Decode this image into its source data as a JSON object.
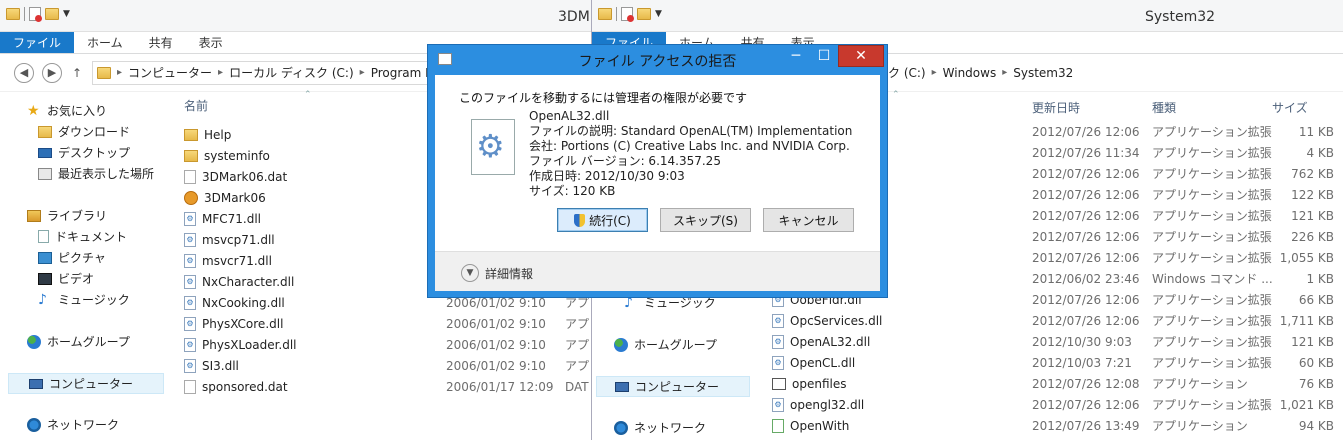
{
  "left_window": {
    "title": "3DM",
    "ribbon_tabs": [
      "ファイル",
      "ホーム",
      "共有",
      "表示"
    ],
    "address": [
      "コンピューター",
      "ローカル ディスク (C:)",
      "Program F"
    ],
    "column_name": "名前",
    "nav": {
      "favorites": "お気に入り",
      "downloads": "ダウンロード",
      "desktop": "デスクトップ",
      "recent": "最近表示した場所",
      "libraries": "ライブラリ",
      "documents": "ドキュメント",
      "pictures": "ピクチャ",
      "videos": "ビデオ",
      "music": "ミュージック",
      "homegroup": "ホームグループ",
      "computer": "コンピューター",
      "network": "ネットワーク"
    },
    "files": [
      {
        "name": "Help",
        "icon": "folder-icon",
        "date": "",
        "type": ""
      },
      {
        "name": "systeminfo",
        "icon": "folder-icon",
        "date": "",
        "type": ""
      },
      {
        "name": "3DMark06.dat",
        "icon": "file-icon",
        "date": "",
        "type": ""
      },
      {
        "name": "3DMark06",
        "icon": "app-icon",
        "date": "",
        "type": ""
      },
      {
        "name": "MFC71.dll",
        "icon": "dll-icon",
        "date": "",
        "type": ""
      },
      {
        "name": "msvcp71.dll",
        "icon": "dll-icon",
        "date": "",
        "type": ""
      },
      {
        "name": "msvcr71.dll",
        "icon": "dll-icon",
        "date": "",
        "type": ""
      },
      {
        "name": "NxCharacter.dll",
        "icon": "dll-icon",
        "date": "",
        "type": ""
      },
      {
        "name": "NxCooking.dll",
        "icon": "dll-icon",
        "date": "2006/01/02 9:10",
        "type": "アプ"
      },
      {
        "name": "PhysXCore.dll",
        "icon": "dll-icon",
        "date": "2006/01/02 9:10",
        "type": "アプ"
      },
      {
        "name": "PhysXLoader.dll",
        "icon": "dll-icon",
        "date": "2006/01/02 9:10",
        "type": "アプ"
      },
      {
        "name": "SI3.dll",
        "icon": "dll-icon",
        "date": "2006/01/02 9:10",
        "type": "アプ"
      },
      {
        "name": "sponsored.dat",
        "icon": "file-icon",
        "date": "2006/01/17 12:09",
        "type": "DAT"
      }
    ]
  },
  "right_window": {
    "title": "System32",
    "ribbon_tabs": [
      "ファイル",
      "ホーム",
      "共有",
      "表示"
    ],
    "address": [
      "スク (C:)",
      "Windows",
      "System32"
    ],
    "columns": {
      "date": "更新日時",
      "type": "種類",
      "size": "サイズ"
    },
    "nav": {
      "music": "ミュージック",
      "homegroup": "ホームグループ",
      "computer": "コンピューター",
      "network": "ネットワーク"
    },
    "files": [
      {
        "name": "",
        "date": "2012/07/26 12:06",
        "type": "アプリケーション拡張",
        "size": "11 KB"
      },
      {
        "name": "",
        "date": "2012/07/26 11:34",
        "type": "アプリケーション拡張",
        "size": "4 KB"
      },
      {
        "name": "",
        "date": "2012/07/26 12:06",
        "type": "アプリケーション拡張",
        "size": "762 KB"
      },
      {
        "name": "",
        "date": "2012/07/26 12:06",
        "type": "アプリケーション拡張",
        "size": "122 KB"
      },
      {
        "name": "",
        "date": "2012/07/26 12:06",
        "type": "アプリケーション拡張",
        "size": "121 KB"
      },
      {
        "name": "",
        "date": "2012/07/26 12:06",
        "type": "アプリケーション拡張",
        "size": "226 KB"
      },
      {
        "name": "",
        "date": "2012/07/26 12:06",
        "type": "アプリケーション拡張",
        "size": "1,055 KB"
      },
      {
        "name": "",
        "date": "2012/06/02 23:46",
        "type": "Windows コマンド ...",
        "size": "1 KB"
      },
      {
        "name": "OobeFldr.dll",
        "date": "2012/07/26 12:06",
        "type": "アプリケーション拡張",
        "size": "66 KB"
      },
      {
        "name": "OpcServices.dll",
        "date": "2012/07/26 12:06",
        "type": "アプリケーション拡張",
        "size": "1,711 KB"
      },
      {
        "name": "OpenAL32.dll",
        "date": "2012/10/30 9:03",
        "type": "アプリケーション拡張",
        "size": "121 KB"
      },
      {
        "name": "OpenCL.dll",
        "date": "2012/10/03 7:21",
        "type": "アプリケーション拡張",
        "size": "60 KB"
      },
      {
        "name": "openfiles",
        "date": "2012/07/26 12:08",
        "type": "アプリケーション",
        "size": "76 KB"
      },
      {
        "name": "opengl32.dll",
        "date": "2012/07/26 12:06",
        "type": "アプリケーション拡張",
        "size": "1,021 KB"
      },
      {
        "name": "OpenWith",
        "date": "2012/07/26 13:49",
        "type": "アプリケーション",
        "size": "94 KB"
      }
    ]
  },
  "dialog": {
    "title": "ファイル アクセスの拒否",
    "message": "このファイルを移動するには管理者の権限が必要です",
    "file_name": "OpenAL32.dll",
    "description": "ファイルの説明: Standard OpenAL(TM) Implementation",
    "company": "会社: Portions (C) Creative Labs Inc. and NVIDIA Corp.",
    "version": "ファイル バージョン: 6.14.357.25",
    "created": "作成日時: 2012/10/30 9:03",
    "size": "サイズ: 120 KB",
    "continue_label": "続行(C)",
    "skip_label": "スキップ(S)",
    "cancel_label": "キャンセル",
    "more_details": "詳細情報",
    "minimize": "─",
    "maximize": "☐",
    "close": "✕"
  },
  "colors": {
    "accent": "#1979ca",
    "dialog_frame": "#2c8ee0",
    "close_red": "#c8392d"
  }
}
